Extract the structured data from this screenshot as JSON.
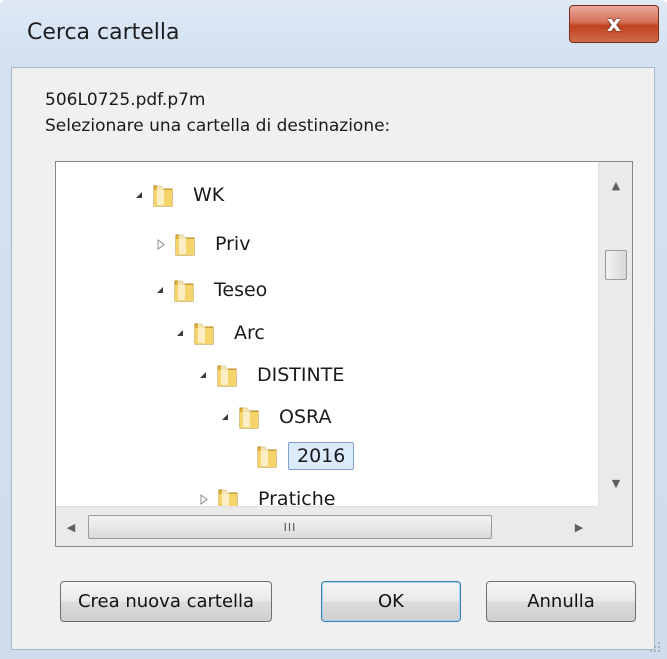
{
  "dialog": {
    "title": "Cerca cartella",
    "close_label": "x"
  },
  "message": {
    "filename": "506L0725.pdf.p7m",
    "prompt": "Selezionare una cartella di destinazione:"
  },
  "tree": {
    "items": [
      {
        "label": "WK",
        "state": "expanded"
      },
      {
        "label": "Priv",
        "state": "collapsed"
      },
      {
        "label": "Teseo",
        "state": "expanded"
      },
      {
        "label": "Arc",
        "state": "expanded"
      },
      {
        "label": "DISTINTE",
        "state": "expanded"
      },
      {
        "label": "OSRA",
        "state": "expanded"
      },
      {
        "label": "2016",
        "state": "leaf",
        "selected": true
      },
      {
        "label": "Pratiche",
        "state": "collapsed"
      }
    ],
    "hscroll_grip": "III"
  },
  "buttons": {
    "new_folder": "Crea nuova cartella",
    "ok": "OK",
    "cancel": "Annulla"
  }
}
